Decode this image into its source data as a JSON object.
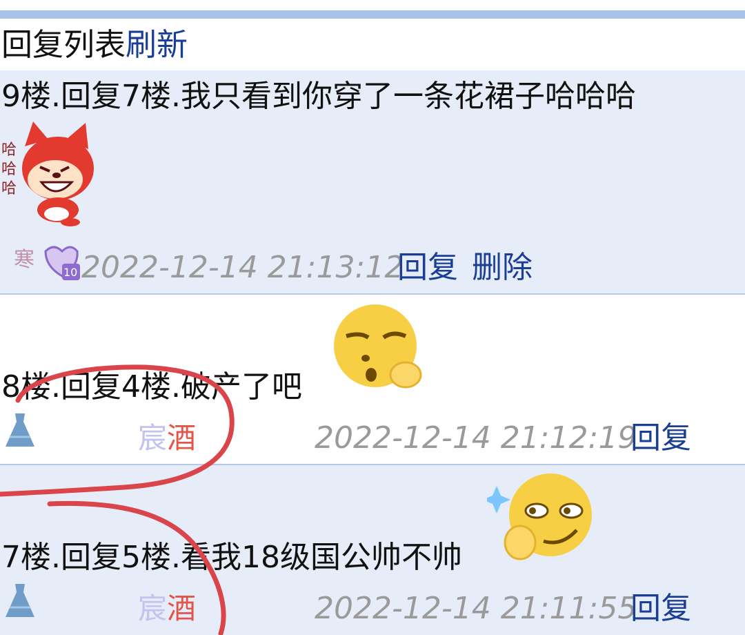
{
  "header": {
    "title": "回复列表",
    "refresh": "刷新"
  },
  "posts": [
    {
      "text": "9楼.回复7楼.我只看到你穿了一条花裙子哈哈哈",
      "sticker_caption": "哈\n哈\n哈",
      "badge_char": "寒",
      "badge_level": "10",
      "time": "2022-12-14 21:13:12",
      "reply": "回复",
      "delete": "删除"
    },
    {
      "text": "8楼.回复4楼.破产了吧",
      "user_a": "宸",
      "user_b": "酒",
      "time": "2022-12-14 21:12:19",
      "reply": "回复"
    },
    {
      "text": "7楼.回复5楼.看我18级国公帅不帅",
      "user_a": "宸",
      "user_b": "酒",
      "time": "2022-12-14 21:11:55",
      "reply": "回复"
    }
  ],
  "colors": {
    "accent": "#1a3e96",
    "post_bg": "#e6edf8",
    "divider": "#b7c8e3",
    "timestamp": "#9a9a9a",
    "annotation": "#d9454b"
  },
  "icons": [
    "fox-laughing-sticker",
    "badge-icon",
    "dress-icon",
    "thinking-emoji",
    "smug-emoji"
  ]
}
